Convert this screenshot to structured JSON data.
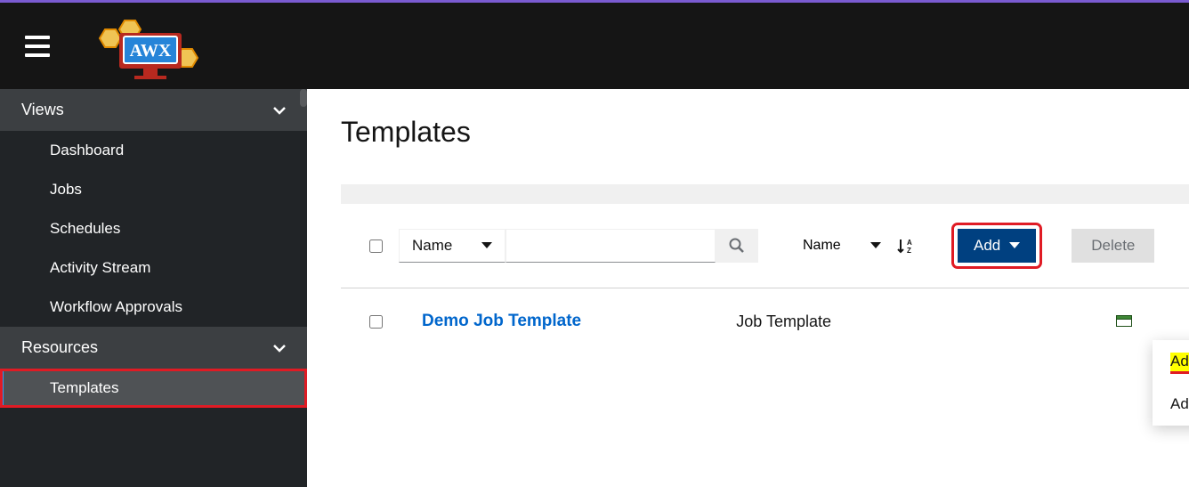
{
  "header": {
    "logo_text": "AWX"
  },
  "sidebar": {
    "sections": {
      "views": {
        "label": "Views",
        "items": [
          "Dashboard",
          "Jobs",
          "Schedules",
          "Activity Stream",
          "Workflow Approvals"
        ]
      },
      "resources": {
        "label": "Resources",
        "items": [
          "Templates"
        ]
      }
    }
  },
  "page": {
    "title": "Templates"
  },
  "toolbar": {
    "filter_key": "Name",
    "sort_key": "Name",
    "add_label": "Add",
    "delete_label": "Delete",
    "add_menu": {
      "job": "Add job template",
      "workflow": "Add workflow template"
    }
  },
  "rows": [
    {
      "name": "Demo Job Template",
      "type": "Job Template",
      "status": "success"
    }
  ]
}
